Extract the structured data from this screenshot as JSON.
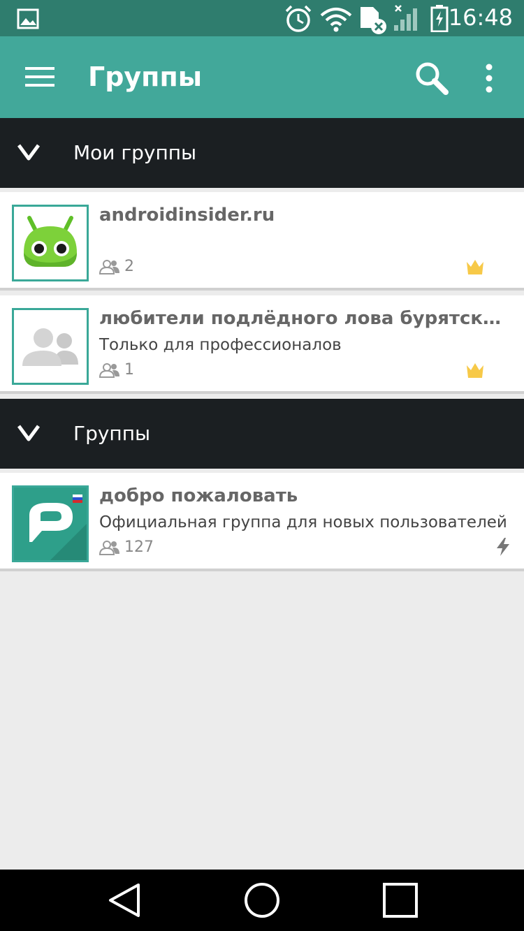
{
  "status": {
    "time": "16:48"
  },
  "appbar": {
    "title": "Группы"
  },
  "sections": [
    {
      "label": "Мои группы"
    },
    {
      "label": "Группы"
    }
  ],
  "groups": [
    {
      "name": "androidinsider.ru",
      "subtitle": "",
      "members": "2",
      "badge": "crown-icon"
    },
    {
      "name": "любители подлёдного лова бурятских тихоокеанских",
      "subtitle": "Только для профессионалов",
      "members": "1",
      "badge": "crown-icon"
    },
    {
      "name": "добро пожаловать",
      "subtitle": "Официальная группа для новых пользователей",
      "members": "127",
      "badge": "lightning-icon"
    }
  ],
  "colors": {
    "statusbar": "#2f7d6e",
    "appbar": "#42a89a",
    "section": "#1b1f22",
    "crown": "#f7c948"
  }
}
